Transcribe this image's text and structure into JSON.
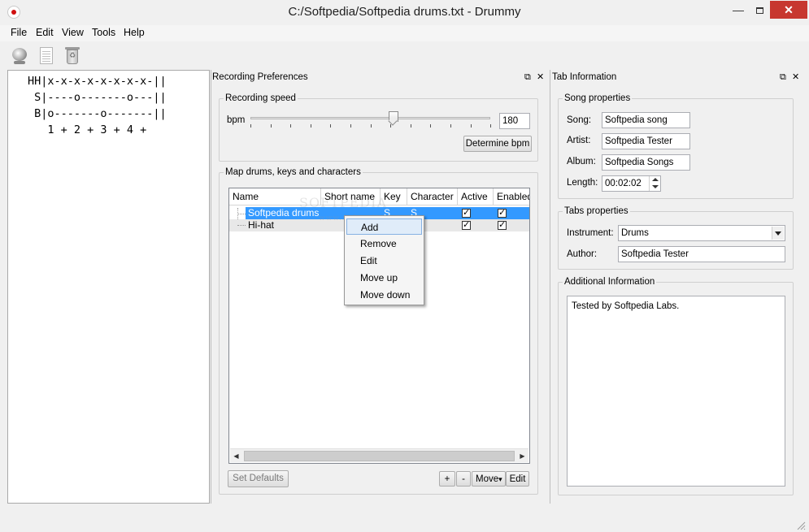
{
  "window": {
    "title": "C:/Softpedia/Softpedia drums.txt - Drummy",
    "minimize_glyph": "—",
    "close_glyph": "✕"
  },
  "menu": [
    "File",
    "Edit",
    "View",
    "Tools",
    "Help"
  ],
  "toolbar": {
    "icons": [
      "record-webcam-icon",
      "document-icon",
      "recycle-bin-icon"
    ]
  },
  "tab_editor": {
    "lines": [
      "HH|x-x-x-x-x-x-x-x-||",
      " S|----o-------o---||",
      " B|o-------o-------||",
      "   1 + 2 + 3 + 4 +"
    ]
  },
  "recording_preferences": {
    "title": "Recording Preferences",
    "float_glyph": "⧉",
    "close_glyph": "✕",
    "speed_group": "Recording speed",
    "bpm_label": "bpm",
    "bpm_value": "180",
    "determine_bpm": "Determine bpm",
    "map_group": "Map drums, keys and characters",
    "columns": [
      "Name",
      "Short name",
      "Key",
      "Character",
      "Active",
      "Enabled"
    ],
    "rows": [
      {
        "name": "Softpedia drums",
        "short": "",
        "key": "S",
        "char": "S",
        "active": true,
        "enabled": true,
        "selected": true
      },
      {
        "name": "Hi-hat",
        "short": "",
        "key": "",
        "char": "",
        "active": true,
        "enabled": true,
        "selected": false
      }
    ],
    "scroll_left": "◀",
    "scroll_right": "▶",
    "set_defaults": "Set Defaults",
    "plus": "+",
    "minus": "-",
    "move": "Move",
    "move_arrow": "▾",
    "edit": "Edit"
  },
  "context_menu": [
    "Add",
    "Remove",
    "Edit",
    "Move up",
    "Move down"
  ],
  "tab_information": {
    "title": "Tab Information",
    "float_glyph": "⧉",
    "close_glyph": "✕",
    "song_group": "Song properties",
    "song_label": "Song:",
    "song_value": "Softpedia song",
    "artist_label": "Artist:",
    "artist_value": "Softpedia Tester",
    "album_label": "Album:",
    "album_value": "Softpedia Songs",
    "length_label": "Length:",
    "length_value": "00:02:02",
    "tabs_group": "Tabs properties",
    "instrument_label": "Instrument:",
    "instrument_value": "Drums",
    "author_label": "Author:",
    "author_value": "Softpedia Tester",
    "additional_group": "Additional Information",
    "additional_text": "Tested by Softpedia Labs."
  },
  "watermark": {
    "main": "SOFTPEDIA",
    "sub": "www.softpedia.com"
  },
  "colors": {
    "selection": "#3399ff",
    "close_button": "#c7372f",
    "record_dot": "#d01010"
  }
}
